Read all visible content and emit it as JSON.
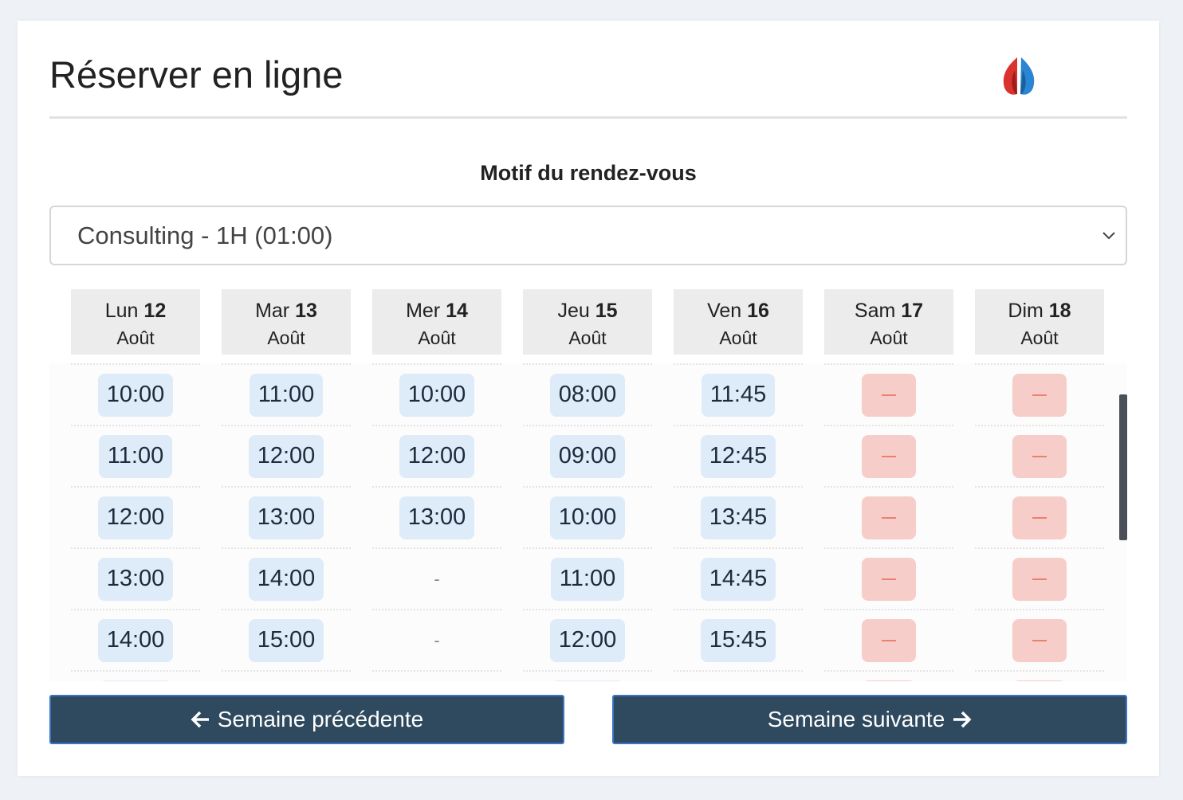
{
  "header": {
    "title": "Réserver en ligne",
    "logo": "flame-logo"
  },
  "form": {
    "motif_label": "Motif du rendez-vous",
    "motif_value": "Consulting - 1H (01:00)"
  },
  "days": [
    {
      "name": "Lun",
      "num": "12",
      "month": "Août",
      "slots": [
        "10:00",
        "11:00",
        "12:00",
        "13:00",
        "14:00"
      ]
    },
    {
      "name": "Mar",
      "num": "13",
      "month": "Août",
      "slots": [
        "11:00",
        "12:00",
        "13:00",
        "14:00",
        "15:00"
      ]
    },
    {
      "name": "Mer",
      "num": "14",
      "month": "Août",
      "slots": [
        "10:00",
        "12:00",
        "13:00",
        "-",
        "-"
      ]
    },
    {
      "name": "Jeu",
      "num": "15",
      "month": "Août",
      "slots": [
        "08:00",
        "09:00",
        "10:00",
        "11:00",
        "12:00"
      ]
    },
    {
      "name": "Ven",
      "num": "16",
      "month": "Août",
      "slots": [
        "11:45",
        "12:45",
        "13:45",
        "14:45",
        "15:45"
      ]
    },
    {
      "name": "Sam",
      "num": "17",
      "month": "Août",
      "slots": [
        "closed",
        "closed",
        "closed",
        "closed",
        "closed"
      ]
    },
    {
      "name": "Dim",
      "num": "18",
      "month": "Août",
      "slots": [
        "closed",
        "closed",
        "closed",
        "closed",
        "closed"
      ]
    }
  ],
  "nav": {
    "prev": "Semaine précédente",
    "next": "Semaine suivante"
  },
  "colors": {
    "slot": "#deebf8",
    "closed": "#f7cdc9",
    "button": "#2f4a5e"
  }
}
